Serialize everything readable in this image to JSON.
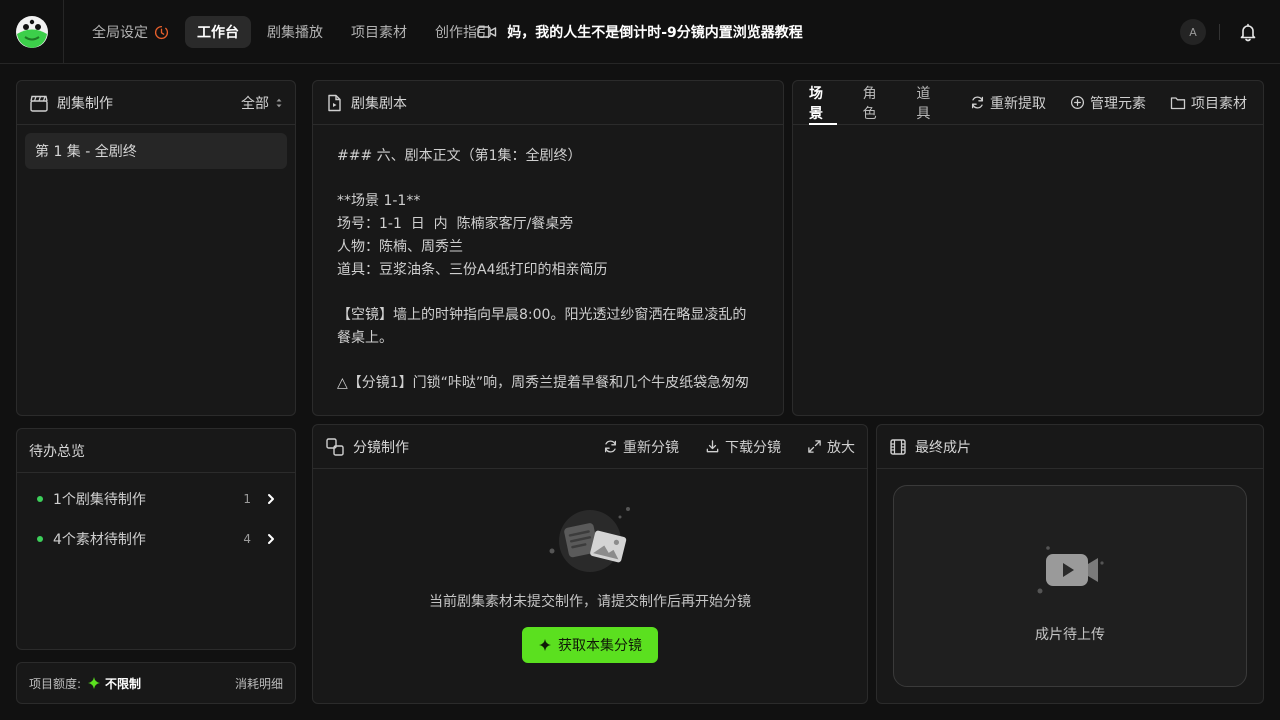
{
  "nav": {
    "items": [
      {
        "label": "全局设定",
        "active": false
      },
      {
        "label": "工作台",
        "active": true
      },
      {
        "label": "剧集播放",
        "active": false
      },
      {
        "label": "项目素材",
        "active": false
      },
      {
        "label": "创作指引",
        "active": false
      }
    ]
  },
  "header": {
    "project_title": "妈，我的人生不是倒计时-9分镜内置浏览器教程",
    "avatar_initial": "A"
  },
  "episodes_panel": {
    "title": "剧集制作",
    "filter_label": "全部",
    "items": [
      {
        "label": "第 1 集 - 全剧终"
      }
    ]
  },
  "todo_panel": {
    "title": "待办总览",
    "items": [
      {
        "label": "1个剧集待制作",
        "count": "1"
      },
      {
        "label": "4个素材待制作",
        "count": "4"
      }
    ]
  },
  "quota": {
    "label": "项目额度:",
    "value": "不限制",
    "detail_link": "消耗明细"
  },
  "script_panel": {
    "title": "剧集剧本",
    "content": "### 六、剧本正文（第1集：全剧终）\n\n**场景 1-1**\n场号：1-1  日  内  陈楠家客厅/餐桌旁\n人物：陈楠、周秀兰\n道具：豆浆油条、三份A4纸打印的相亲简历\n\n【空镜】墙上的时钟指向早晨8:00。阳光透过纱窗洒在略显凌乱的餐桌上。\n\n△【分镜1】门锁“咔哒”响，周秀兰提着早餐和几个牛皮纸袋急匆匆"
  },
  "elements_panel": {
    "tabs": [
      {
        "label": "场景",
        "active": true
      },
      {
        "label": "角色",
        "active": false
      },
      {
        "label": "道具",
        "active": false
      }
    ],
    "actions": {
      "re_extract": "重新提取",
      "manage": "管理元素",
      "assets": "项目素材"
    }
  },
  "storyboard_panel": {
    "title": "分镜制作",
    "actions": {
      "regenerate": "重新分镜",
      "download": "下载分镜",
      "zoom": "放大"
    },
    "empty_text": "当前剧集素材未提交制作，请提交制作后再开始分镜",
    "cta_label": "获取本集分镜"
  },
  "final_panel": {
    "title": "最终成片",
    "upload_text": "成片待上传"
  },
  "colors": {
    "accent_green": "#5be01f",
    "status_dot": "#3ccf5a",
    "clock_icon": "#e8602c",
    "background": "#111111",
    "panel": "#181818"
  }
}
